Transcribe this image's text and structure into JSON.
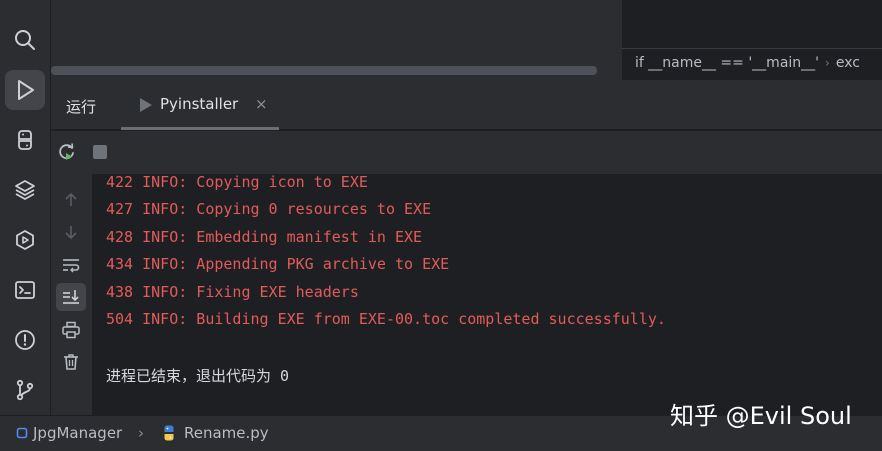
{
  "editor": {
    "code_snippet": "if __name__ == '__main__'",
    "code_snippet_tail": "exc"
  },
  "run_panel": {
    "title": "运行",
    "tab_label": "Pyinstaller",
    "tab_close": "×"
  },
  "console": {
    "lines": [
      "422 INFO: Copying icon to EXE",
      "427 INFO: Copying 0 resources to EXE",
      "428 INFO: Embedding manifest in EXE",
      "434 INFO: Appending PKG archive to EXE",
      "438 INFO: Fixing EXE headers",
      "504 INFO: Building EXE from EXE-00.toc completed successfully."
    ],
    "exit_message": "进程已结束，退出代码为 0"
  },
  "status_bar": {
    "project": "JpgManager",
    "file": "Rename.py"
  },
  "watermark": "知乎 @Evil Soul",
  "colors": {
    "error_text": "#e25b5b",
    "panel_bg": "#2b2d30",
    "console_bg": "#1e1f22"
  },
  "icons": {
    "activity_bar": [
      "search-icon",
      "run-icon",
      "python-icon",
      "layers-icon",
      "services-icon",
      "terminal-icon",
      "problems-icon",
      "git-icon"
    ],
    "run_toolbar": [
      "rerun-icon",
      "stop-icon"
    ],
    "console_gutter": [
      "scroll-up-icon",
      "scroll-down-icon",
      "soft-wrap-icon",
      "scroll-to-end-icon",
      "print-icon",
      "trash-icon"
    ]
  }
}
